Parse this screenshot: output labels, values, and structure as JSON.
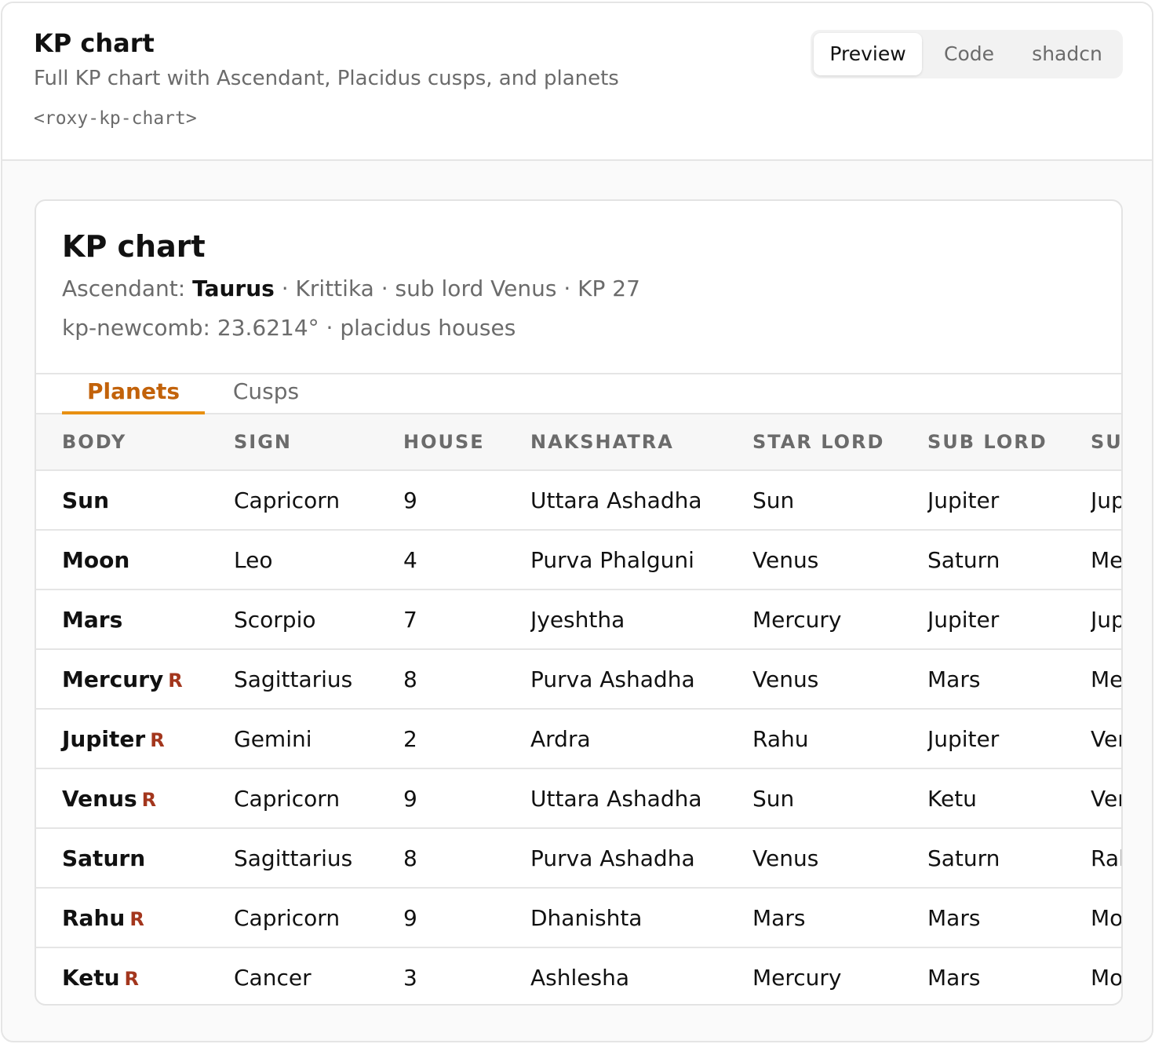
{
  "header": {
    "title": "KP chart",
    "description": "Full KP chart with Ascendant, Placidus cusps, and planets",
    "tag": "<roxy-kp-chart>",
    "view_tabs": [
      "Preview",
      "Code",
      "shadcn"
    ],
    "active_view": "Preview"
  },
  "card": {
    "title": "KP chart",
    "ascendant_label": "Ascendant:",
    "ascendant_sign": "Taurus",
    "ascendant_details": "· Krittika · sub lord Venus · KP 27",
    "ayanamsa_line": "kp-newcomb: 23.6214° · placidus houses",
    "tabs": [
      "Planets",
      "Cusps"
    ],
    "active_tab": "Planets",
    "retro_marker": "R",
    "columns": [
      "BODY",
      "SIGN",
      "HOUSE",
      "NAKSHATRA",
      "STAR LORD",
      "SUB LORD",
      "SU"
    ],
    "rows": [
      {
        "body": "Sun",
        "retro": false,
        "sign": "Capricorn",
        "house": "9",
        "nakshatra": "Uttara Ashadha",
        "star_lord": "Sun",
        "sub_lord": "Jupiter",
        "sub_sub": "Jup"
      },
      {
        "body": "Moon",
        "retro": false,
        "sign": "Leo",
        "house": "4",
        "nakshatra": "Purva Phalguni",
        "star_lord": "Venus",
        "sub_lord": "Saturn",
        "sub_sub": "Me"
      },
      {
        "body": "Mars",
        "retro": false,
        "sign": "Scorpio",
        "house": "7",
        "nakshatra": "Jyeshtha",
        "star_lord": "Mercury",
        "sub_lord": "Jupiter",
        "sub_sub": "Jup"
      },
      {
        "body": "Mercury",
        "retro": true,
        "sign": "Sagittarius",
        "house": "8",
        "nakshatra": "Purva Ashadha",
        "star_lord": "Venus",
        "sub_lord": "Mars",
        "sub_sub": "Me"
      },
      {
        "body": "Jupiter",
        "retro": true,
        "sign": "Gemini",
        "house": "2",
        "nakshatra": "Ardra",
        "star_lord": "Rahu",
        "sub_lord": "Jupiter",
        "sub_sub": "Ver"
      },
      {
        "body": "Venus",
        "retro": true,
        "sign": "Capricorn",
        "house": "9",
        "nakshatra": "Uttara Ashadha",
        "star_lord": "Sun",
        "sub_lord": "Ketu",
        "sub_sub": "Ver"
      },
      {
        "body": "Saturn",
        "retro": false,
        "sign": "Sagittarius",
        "house": "8",
        "nakshatra": "Purva Ashadha",
        "star_lord": "Venus",
        "sub_lord": "Saturn",
        "sub_sub": "Ral"
      },
      {
        "body": "Rahu",
        "retro": true,
        "sign": "Capricorn",
        "house": "9",
        "nakshatra": "Dhanishta",
        "star_lord": "Mars",
        "sub_lord": "Mars",
        "sub_sub": "Mo"
      },
      {
        "body": "Ketu",
        "retro": true,
        "sign": "Cancer",
        "house": "3",
        "nakshatra": "Ashlesha",
        "star_lord": "Mercury",
        "sub_lord": "Mars",
        "sub_sub": "Mo"
      }
    ]
  },
  "colors": {
    "accent": "#c2620a",
    "accent_underline": "#e89012",
    "retro": "#a3361d",
    "muted_text": "#6b6b6b"
  }
}
